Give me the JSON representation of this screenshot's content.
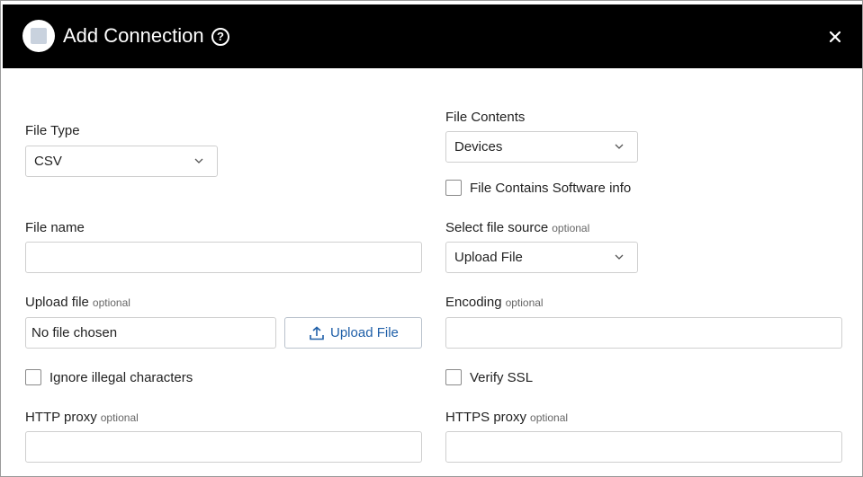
{
  "dialog": {
    "title": "Add Connection",
    "help_icon": "help-circle-icon",
    "close_icon": "close-icon",
    "logo_icon": "adapter-logo-icon"
  },
  "form": {
    "file_type": {
      "label": "File Type",
      "value": "CSV"
    },
    "file_contents": {
      "label": "File Contents",
      "value": "Devices"
    },
    "software_info": {
      "label": "File Contains Software info",
      "checked": false
    },
    "file_name": {
      "label": "File name",
      "value": ""
    },
    "file_source": {
      "label": "Select file source",
      "optional": "optional",
      "value": "Upload File"
    },
    "upload_file": {
      "label": "Upload file",
      "optional": "optional",
      "value": "No file chosen",
      "button": "Upload File"
    },
    "encoding": {
      "label": "Encoding",
      "optional": "optional",
      "value": ""
    },
    "ignore_illegal": {
      "label": "Ignore illegal characters",
      "checked": false
    },
    "verify_ssl": {
      "label": "Verify SSL",
      "checked": false
    },
    "http_proxy": {
      "label": "HTTP proxy",
      "optional": "optional",
      "value": ""
    },
    "https_proxy": {
      "label": "HTTPS proxy",
      "optional": "optional",
      "value": ""
    }
  },
  "colors": {
    "header_bg": "#000000",
    "link_blue": "#1f5fa8",
    "border": "#cfcfcf"
  }
}
